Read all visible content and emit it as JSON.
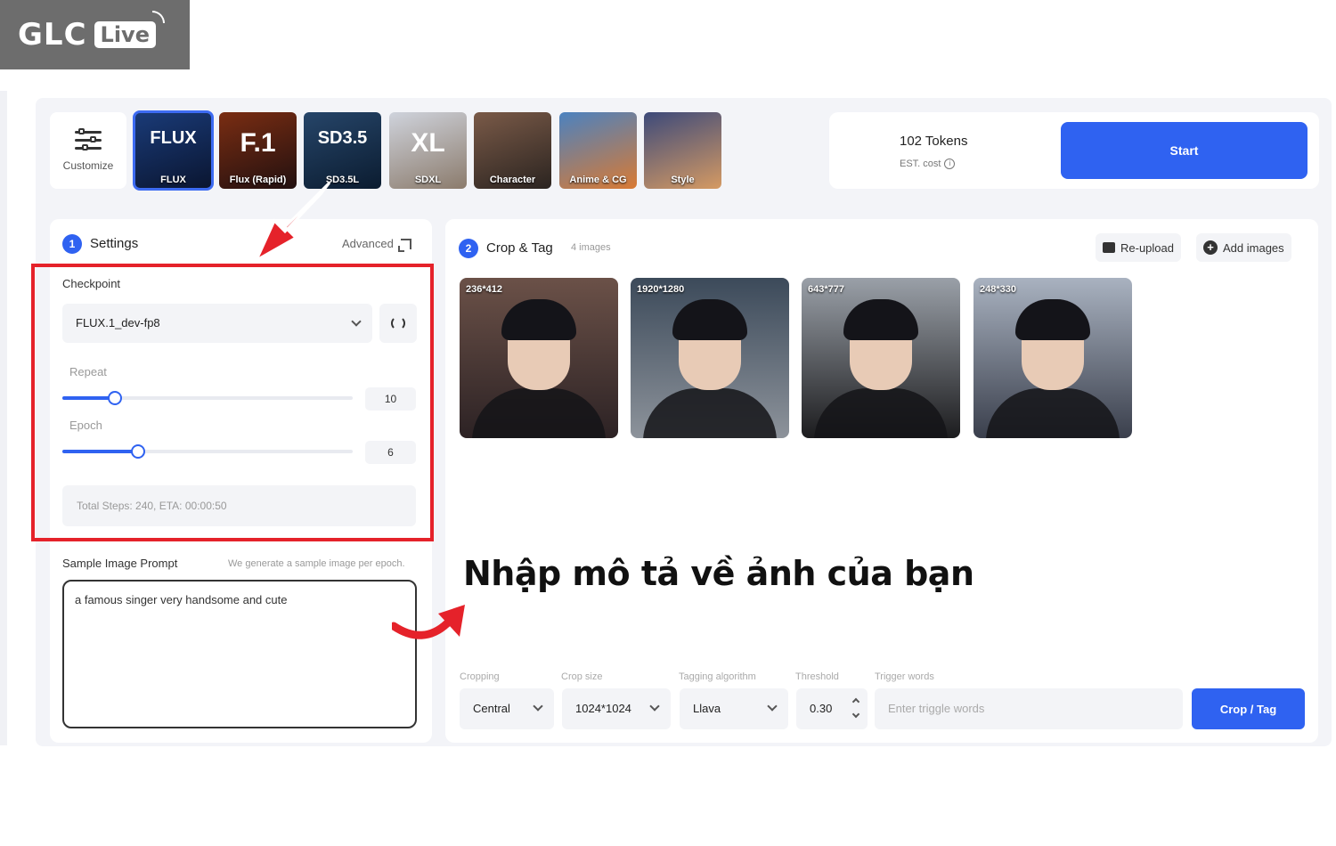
{
  "watermark": {
    "brand": "GLC",
    "badge": "Live"
  },
  "topbar": {
    "customize_label": "Customize",
    "models": [
      {
        "big": "FLUX",
        "label": "FLUX",
        "colors": [
          "#1a3b78",
          "#0a1530"
        ],
        "selected": true
      },
      {
        "big": "F.1",
        "label": "Flux (Rapid)",
        "colors": [
          "#7a2d12",
          "#221010"
        ]
      },
      {
        "big": "SD3.5",
        "label": "SD3.5L",
        "colors": [
          "#264569",
          "#0b1c30"
        ]
      },
      {
        "big": "XL",
        "label": "SDXL",
        "colors": [
          "#cfd3dc",
          "#8b7b6c"
        ]
      },
      {
        "big": "",
        "label": "Character",
        "colors": [
          "#7a5a48",
          "#2b2420"
        ]
      },
      {
        "big": "",
        "label": "Anime & CG",
        "colors": [
          "#4b82c0",
          "#d97a33"
        ]
      },
      {
        "big": "",
        "label": "Style",
        "colors": [
          "#3d4a7a",
          "#d59a63"
        ]
      }
    ],
    "tokens": "102 Tokens",
    "est_cost": "EST. cost",
    "start_label": "Start"
  },
  "settings": {
    "step": "1",
    "title": "Settings",
    "advanced": "Advanced",
    "checkpoint_label": "Checkpoint",
    "checkpoint_value": "FLUX.1_dev-fp8",
    "repeat_label": "Repeat",
    "repeat_value": "10",
    "repeat_fraction": 0.18,
    "epoch_label": "Epoch",
    "epoch_value": "6",
    "epoch_fraction": 0.26,
    "total": "Total Steps: 240,  ETA: 00:00:50",
    "sample_label": "Sample Image Prompt",
    "sample_hint": "We generate a sample image per epoch.",
    "sample_text": "a famous singer very handsome and cute"
  },
  "crop": {
    "step": "2",
    "title": "Crop & Tag",
    "count": "4 images",
    "reupload": "Re-upload",
    "add_images": "Add images",
    "images": [
      {
        "dim": "236*412",
        "colors": [
          "#6b5148",
          "#2c2224"
        ]
      },
      {
        "dim": "1920*1280",
        "colors": [
          "#3c4a5a",
          "#8d939b"
        ]
      },
      {
        "dim": "643*777",
        "colors": [
          "#9aa0a8",
          "#1c1c1e"
        ]
      },
      {
        "dim": "248*330",
        "colors": [
          "#a9b2c0",
          "#3a3f4c"
        ]
      }
    ],
    "caption": "Nhập mô tả về ảnh của bạn",
    "cropping_label": "Cropping",
    "cropping_value": "Central",
    "cropsize_label": "Crop size",
    "cropsize_value": "1024*1024",
    "tagging_label": "Tagging algorithm",
    "tagging_value": "Llava",
    "threshold_label": "Threshold",
    "threshold_value": "0.30",
    "trigger_label": "Trigger words",
    "trigger_placeholder": "Enter triggle words",
    "crop_btn": "Crop / Tag"
  }
}
